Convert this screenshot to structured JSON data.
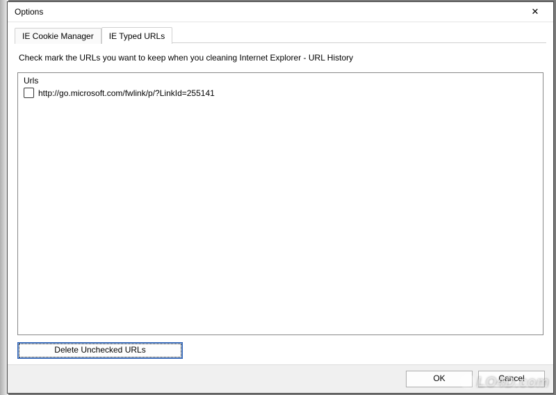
{
  "window": {
    "title": "Options"
  },
  "tabs": [
    {
      "label": "IE Cookie Manager",
      "active": false
    },
    {
      "label": "IE Typed URLs",
      "active": true
    }
  ],
  "instruction": "Check mark the URLs you want to keep when you cleaning Internet Explorer - URL History",
  "listbox": {
    "header": "Urls",
    "items": [
      {
        "checked": false,
        "url": "http://go.microsoft.com/fwlink/p/?LinkId=255141"
      }
    ]
  },
  "buttons": {
    "delete": "Delete Unchecked URLs",
    "ok": "OK",
    "cancel": "Cancel"
  },
  "watermark": "LO4D.com"
}
